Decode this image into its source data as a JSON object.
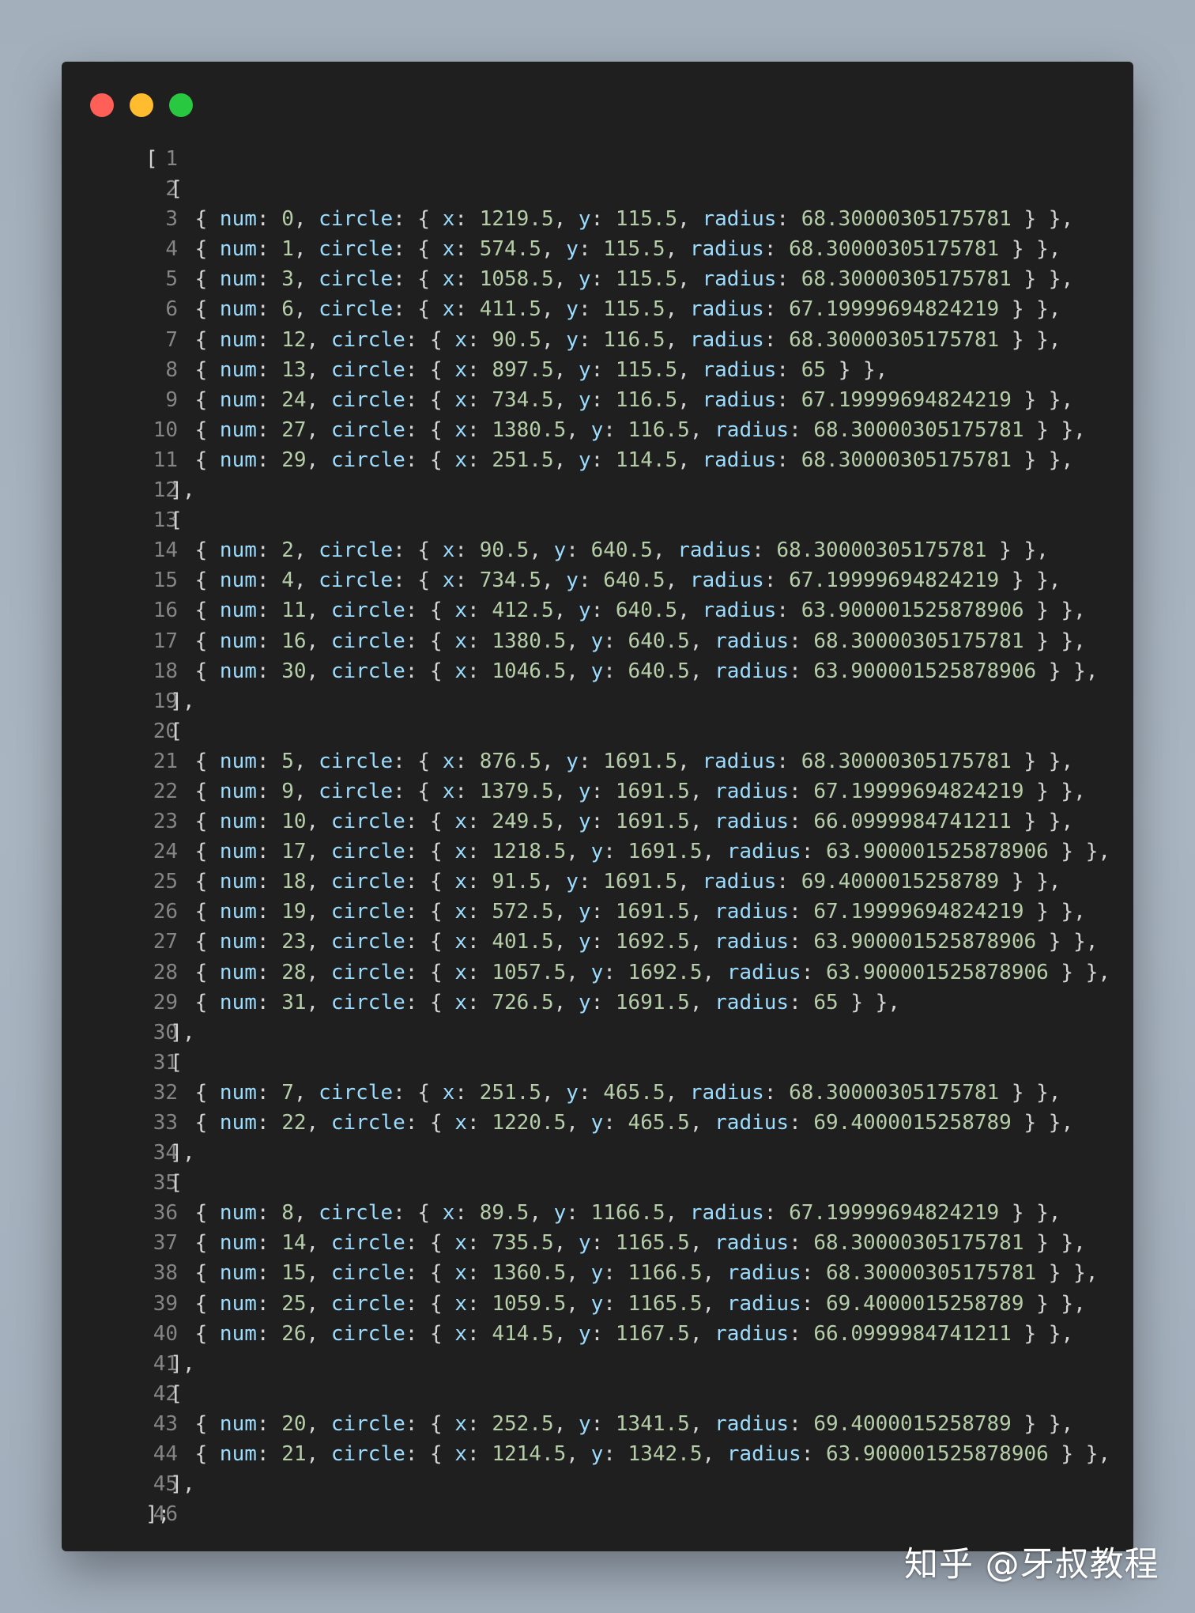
{
  "colors": {
    "background": "#a6b2be",
    "editor_bg": "#1f1f1f",
    "line_number": "#858585",
    "punctuation": "#d4d4d4",
    "key": "#9cdcfe",
    "number": "#b5cea8"
  },
  "window_controls": [
    {
      "name": "close-icon",
      "color": "#fe5f57"
    },
    {
      "name": "minimize-icon",
      "color": "#febc2e"
    },
    {
      "name": "maximize-icon",
      "color": "#28c840"
    }
  ],
  "code": {
    "lines": [
      "[",
      "  [",
      "    { num: 0, circle: { x: 1219.5, y: 115.5, radius: 68.30000305175781 } },",
      "    { num: 1, circle: { x: 574.5, y: 115.5, radius: 68.30000305175781 } },",
      "    { num: 3, circle: { x: 1058.5, y: 115.5, radius: 68.30000305175781 } },",
      "    { num: 6, circle: { x: 411.5, y: 115.5, radius: 67.19999694824219 } },",
      "    { num: 12, circle: { x: 90.5, y: 116.5, radius: 68.30000305175781 } },",
      "    { num: 13, circle: { x: 897.5, y: 115.5, radius: 65 } },",
      "    { num: 24, circle: { x: 734.5, y: 116.5, radius: 67.19999694824219 } },",
      "    { num: 27, circle: { x: 1380.5, y: 116.5, radius: 68.30000305175781 } },",
      "    { num: 29, circle: { x: 251.5, y: 114.5, radius: 68.30000305175781 } },",
      "  ],",
      "  [",
      "    { num: 2, circle: { x: 90.5, y: 640.5, radius: 68.30000305175781 } },",
      "    { num: 4, circle: { x: 734.5, y: 640.5, radius: 67.19999694824219 } },",
      "    { num: 11, circle: { x: 412.5, y: 640.5, radius: 63.900001525878906 } },",
      "    { num: 16, circle: { x: 1380.5, y: 640.5, radius: 68.30000305175781 } },",
      "    { num: 30, circle: { x: 1046.5, y: 640.5, radius: 63.900001525878906 } },",
      "  ],",
      "  [",
      "    { num: 5, circle: { x: 876.5, y: 1691.5, radius: 68.30000305175781 } },",
      "    { num: 9, circle: { x: 1379.5, y: 1691.5, radius: 67.19999694824219 } },",
      "    { num: 10, circle: { x: 249.5, y: 1691.5, radius: 66.0999984741211 } },",
      "    { num: 17, circle: { x: 1218.5, y: 1691.5, radius: 63.900001525878906 } },",
      "    { num: 18, circle: { x: 91.5, y: 1691.5, radius: 69.4000015258789 } },",
      "    { num: 19, circle: { x: 572.5, y: 1691.5, radius: 67.19999694824219 } },",
      "    { num: 23, circle: { x: 401.5, y: 1692.5, radius: 63.900001525878906 } },",
      "    { num: 28, circle: { x: 1057.5, y: 1692.5, radius: 63.900001525878906 } },",
      "    { num: 31, circle: { x: 726.5, y: 1691.5, radius: 65 } },",
      "  ],",
      "  [",
      "    { num: 7, circle: { x: 251.5, y: 465.5, radius: 68.30000305175781 } },",
      "    { num: 22, circle: { x: 1220.5, y: 465.5, radius: 69.4000015258789 } },",
      "  ],",
      "  [",
      "    { num: 8, circle: { x: 89.5, y: 1166.5, radius: 67.19999694824219 } },",
      "    { num: 14, circle: { x: 735.5, y: 1165.5, radius: 68.30000305175781 } },",
      "    { num: 15, circle: { x: 1360.5, y: 1166.5, radius: 68.30000305175781 } },",
      "    { num: 25, circle: { x: 1059.5, y: 1165.5, radius: 69.4000015258789 } },",
      "    { num: 26, circle: { x: 414.5, y: 1167.5, radius: 66.0999984741211 } },",
      "  ],",
      "  [",
      "    { num: 20, circle: { x: 252.5, y: 1341.5, radius: 69.4000015258789 } },",
      "    { num: 21, circle: { x: 1214.5, y: 1342.5, radius: 63.900001525878906 } },",
      "  ],",
      "];"
    ]
  },
  "watermark": "知乎 @牙叔教程"
}
